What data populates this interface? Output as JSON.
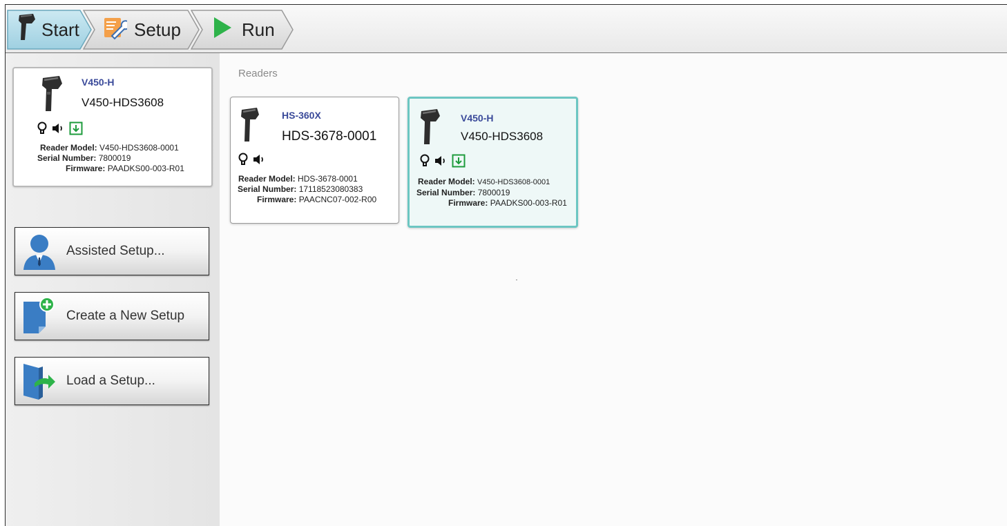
{
  "nav": {
    "start_label": "Start",
    "setup_label": "Setup",
    "run_label": "Run"
  },
  "active_reader": {
    "model_name": "V450-H",
    "model_id": "V450-HDS3608",
    "reader_model_label": "Reader Model:",
    "reader_model": "V450-HDS3608-0001",
    "serial_label": "Serial Number:",
    "serial": "7800019",
    "firmware_label": "Firmware:",
    "firmware": "PAADKS00-003-R01"
  },
  "actions": {
    "assisted_setup": "Assisted Setup...",
    "create_new_setup": "Create a New Setup",
    "load_setup": "Load a Setup..."
  },
  "readers": {
    "title": "Readers",
    "items": [
      {
        "model_name": "HS-360X",
        "model_id": "HDS-3678-0001",
        "reader_model_label": "Reader Model:",
        "reader_model": "HDS-3678-0001",
        "serial_label": "Serial Number:",
        "serial": "17118523080383",
        "firmware_label": "Firmware:",
        "firmware": "PAACNC07-002-R00"
      },
      {
        "model_name": "V450-H",
        "model_id": "V450-HDS3608",
        "reader_model_label": "Reader Model:",
        "reader_model": "V450-HDS3608-0001",
        "serial_label": "Serial Number:",
        "serial": "7800019",
        "firmware_label": "Firmware:",
        "firmware": "PAADKS00-003-R01"
      }
    ]
  },
  "colors": {
    "start_tab": "#a9d7e6",
    "selected_card_border": "#6cc6c2",
    "selected_card_bg": "#eef8f7",
    "model_name": "#3a4a9a",
    "run_icon": "#2eb34a",
    "download_icon": "#1e9b3c"
  }
}
